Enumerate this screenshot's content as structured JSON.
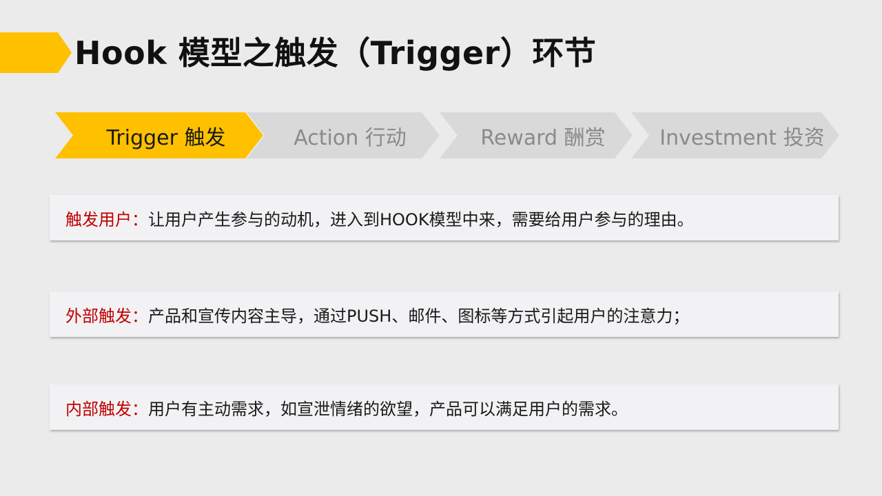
{
  "slide": {
    "title": "Hook 模型之触发（Trigger）环节",
    "accent_color": "#ffc000"
  },
  "steps": [
    {
      "label": "Trigger 触发",
      "active": true
    },
    {
      "label": "Action 行动",
      "active": false
    },
    {
      "label": "Reward 酬赏",
      "active": false
    },
    {
      "label": "Investment 投资",
      "active": false
    }
  ],
  "items": [
    {
      "label": "触发用户",
      "separator": "：",
      "text": "让用户产生参与的动机，进入到HOOK模型中来，需要给用户参与的理由。"
    },
    {
      "label": "外部触发",
      "separator": "：",
      "text": "产品和宣传内容主导，通过PUSH、邮件、图标等方式引起用户的注意力；"
    },
    {
      "label": "内部触发",
      "separator": "：",
      "text": "用户有主动需求，如宣泄情绪的欲望，产品可以满足用户的需求。"
    }
  ],
  "colors": {
    "active_step": "#ffc000",
    "inactive_step": "#d9d9d9",
    "label_red": "#c00000"
  }
}
